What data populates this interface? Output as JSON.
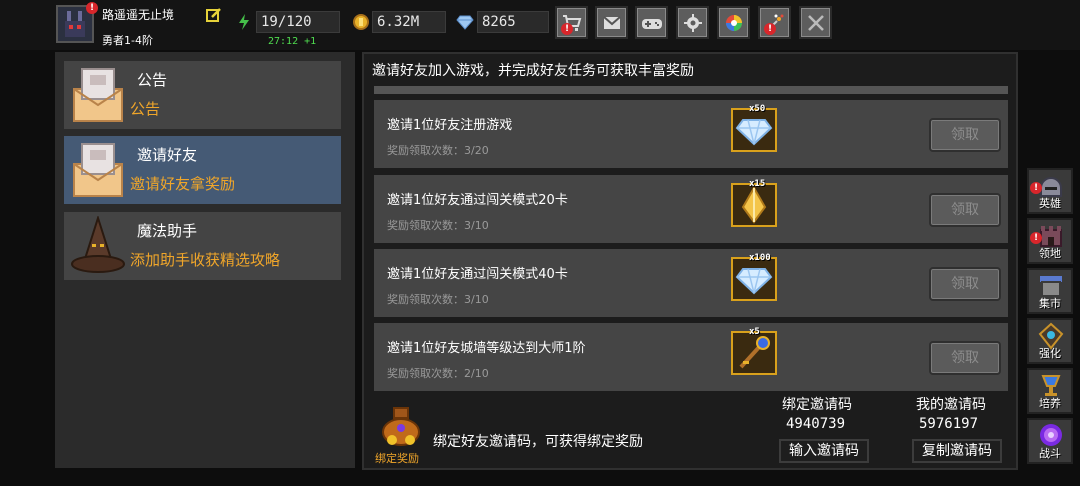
{
  "player": {
    "name": "路遥遥无止境",
    "rank": "勇者1-4阶"
  },
  "stats": {
    "energy": "19/120",
    "energy_timer": "27:12 +1",
    "gold": "6.32M",
    "gems": "8265"
  },
  "top_buttons": [
    "shop-cart-icon",
    "mail-icon",
    "gamepad-icon",
    "settings-gear-icon",
    "color-wheel-icon",
    "fireworks-icon",
    "crossed-swords-icon"
  ],
  "menu": {
    "items": [
      {
        "title": "公告",
        "subtitle": "公告",
        "icon": "scroll-icon"
      },
      {
        "title": "邀请好友",
        "subtitle": "邀请好友拿奖励",
        "icon": "scroll-icon"
      },
      {
        "title": "魔法助手",
        "subtitle": "添加助手收获精选攻略",
        "icon": "wizard-hat-icon"
      }
    ]
  },
  "main": {
    "header": "邀请好友加入游戏，并完成好友任务可获取丰富奖励",
    "tasks": [
      {
        "title": "邀请1位好友注册游戏",
        "count": "奖励领取次数：3/20",
        "reward_icon": "diamond-icon",
        "reward_qty": "x50",
        "button": "领取"
      },
      {
        "title": "邀请1位好友通过闯关模式20卡",
        "count": "奖励领取次数：3/10",
        "reward_icon": "gold-crystal-icon",
        "reward_qty": "x15",
        "button": "领取"
      },
      {
        "title": "邀请1位好友通过闯关模式40卡",
        "count": "奖励领取次数：3/10",
        "reward_icon": "diamond-icon",
        "reward_qty": "x100",
        "button": "领取"
      },
      {
        "title": "邀请1位好友城墙等级达到大师1阶",
        "count": "奖励领取次数：2/10",
        "reward_icon": "magic-key-icon",
        "reward_qty": "x5",
        "button": "领取"
      }
    ]
  },
  "bind": {
    "label": "绑定奖励",
    "text": "绑定好友邀请码，可获得绑定奖励",
    "bind_code_title": "绑定邀请码",
    "bind_code": "4940739",
    "bind_button": "输入邀请码",
    "my_code_title": "我的邀请码",
    "my_code": "5976197",
    "copy_button": "复制邀请码"
  },
  "side_nav": [
    {
      "label": "英雄",
      "icon": "knight-helmet-icon"
    },
    {
      "label": "领地",
      "icon": "castle-icon"
    },
    {
      "label": "集市",
      "icon": "market-stall-icon"
    },
    {
      "label": "强化",
      "icon": "rune-shield-icon"
    },
    {
      "label": "培养",
      "icon": "goblet-icon"
    },
    {
      "label": "战斗",
      "icon": "portal-icon"
    }
  ],
  "colors": {
    "accent_orange": "#f0a62a",
    "active_menu": "#455a75",
    "timer_green": "#4fdc4f",
    "alert_red": "#d8262b"
  }
}
